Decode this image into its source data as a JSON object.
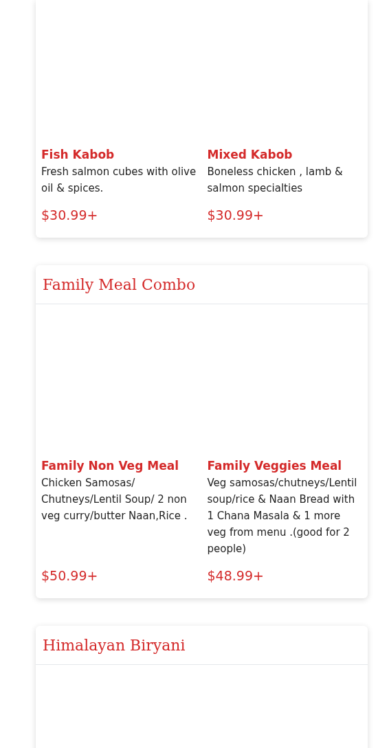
{
  "sections": [
    {
      "items": [
        {
          "name": "Fish Kabob",
          "description": "Fresh salmon cubes with olive oil & spices.",
          "price": "$30.99+"
        },
        {
          "name": "Mixed Kabob",
          "description": "Boneless chicken , lamb & salmon specialties",
          "price": "$30.99+"
        }
      ]
    },
    {
      "title": "Family Meal Combo",
      "items": [
        {
          "name": "Family Non Veg Meal",
          "description": "Chicken Samosas/ Chutneys/Lentil Soup/ 2 non veg curry/butter Naan,Rice .",
          "price": "$50.99+"
        },
        {
          "name": "Family Veggies Meal",
          "description": "Veg samosas/chutneys/Lentil soup/rice & Naan Bread with 1 Chana Masala & 1 more veg from menu .(good for 2 people)",
          "price": "$48.99+"
        }
      ]
    },
    {
      "title": "Himalayan Biryani"
    }
  ]
}
